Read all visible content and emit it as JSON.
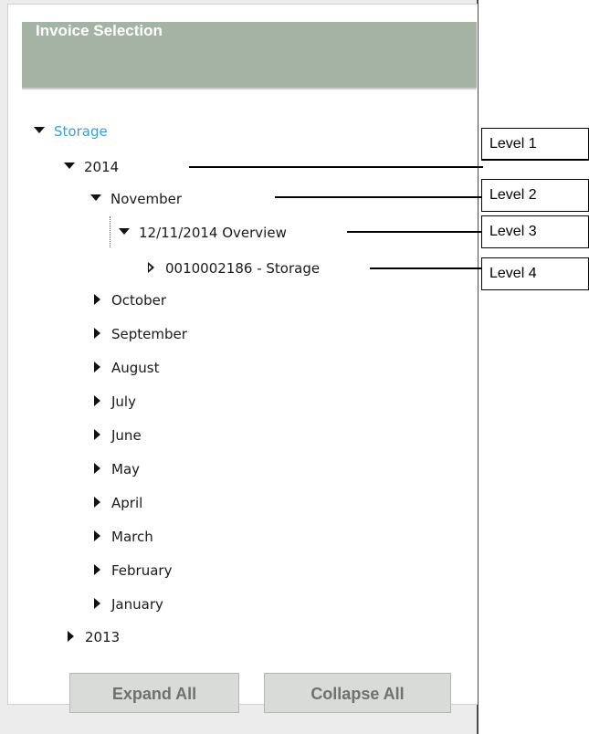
{
  "panel": {
    "title": "Invoice Selection"
  },
  "tree": {
    "root": {
      "label": "Storage",
      "state": "expanded"
    },
    "year_2014": {
      "label": "2014",
      "state": "expanded"
    },
    "november": {
      "label": "November",
      "state": "expanded"
    },
    "overview": {
      "label": "12/11/2014 Overview",
      "state": "expanded"
    },
    "invoice": {
      "label": "0010002186 - Storage",
      "state": "collapsed"
    },
    "months": [
      {
        "label": "October",
        "state": "collapsed"
      },
      {
        "label": "September",
        "state": "collapsed"
      },
      {
        "label": "August",
        "state": "collapsed"
      },
      {
        "label": "July",
        "state": "collapsed"
      },
      {
        "label": "June",
        "state": "collapsed"
      },
      {
        "label": "May",
        "state": "collapsed"
      },
      {
        "label": "April",
        "state": "collapsed"
      },
      {
        "label": "March",
        "state": "collapsed"
      },
      {
        "label": "February",
        "state": "collapsed"
      },
      {
        "label": "January",
        "state": "collapsed"
      }
    ],
    "year_2013": {
      "label": "2013",
      "state": "collapsed"
    }
  },
  "buttons": {
    "expand_all": "Expand All",
    "collapse_all": "Collapse All"
  },
  "callouts": [
    {
      "label": "Level 1"
    },
    {
      "label": "Level 2"
    },
    {
      "label": "Level 3"
    },
    {
      "label": "Level 4"
    }
  ],
  "colors": {
    "header_bg": "#a5b3a4",
    "link": "#3aa0d8",
    "button_bg": "#d8dbd8",
    "button_text": "#6e726e"
  }
}
